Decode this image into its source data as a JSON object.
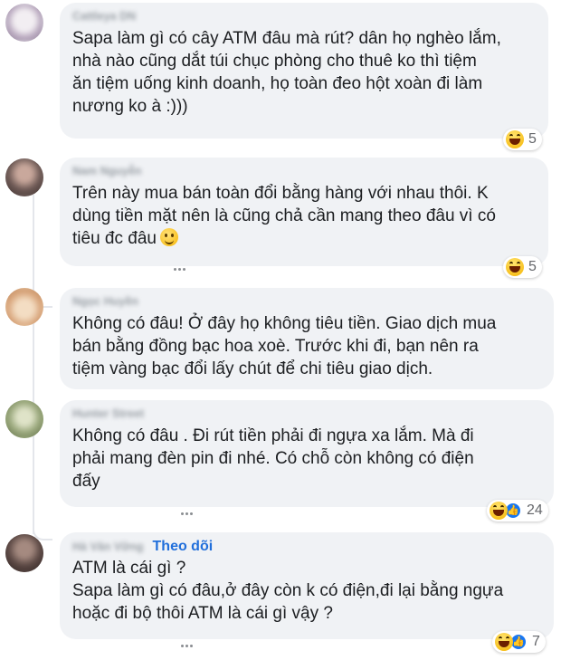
{
  "comments": [
    {
      "author": "Cattleya DN",
      "lines": [
        "Sapa làm gì có cây ATM đâu mà rút? dân họ nghèo lắm,",
        "nhà nào cũng dắt túi chục phòng cho thuê ko thì tiệm",
        "ăn tiệm uống kinh doanh, họ toàn đeo hột xoàn đi làm",
        "nương ko à :)))"
      ],
      "reactions": [
        "haha"
      ],
      "reaction_count": "5"
    },
    {
      "author": "Nam Nguyễn",
      "lines": [
        "Trên này mua bán toàn đổi bằng hàng với nhau thôi. K",
        "dùng tiền mặt nên là cũng chả cần mang theo đâu vì có",
        "tiêu đc đâu"
      ],
      "reactions": [
        "haha"
      ],
      "reaction_count": "5"
    },
    {
      "author": "Ngọc Huyền",
      "lines": [
        "Không có đâu! Ở đây họ không tiêu tiền. Giao dịch mua",
        "bán bằng đồng bạc hoa xoè. Trước khi đi, bạn nên ra",
        "tiệm vàng bạc đổi lấy chút để chi tiêu giao dịch."
      ]
    },
    {
      "author": "Hunter Street",
      "lines": [
        "Không có đâu . Đi rút tiền phải đi ngựa xa lắm. Mà đi",
        "phải mang đèn pin đi nhé. Có chỗ còn không có điện",
        "đấy"
      ],
      "reactions": [
        "haha",
        "like"
      ],
      "reaction_count": "24"
    },
    {
      "author": "Hà Văn Vững",
      "follow": "Theo dõi",
      "lines": [
        "ATM là cái gì ?",
        "Sapa làm gì có đâu,ở đây còn k có điện,đi lại bằng ngựa",
        "hoặc đi bộ thôi ATM là cái gì vậy ?"
      ],
      "reactions": [
        "haha",
        "like"
      ],
      "reaction_count": "7"
    }
  ],
  "colors": {
    "bubble": "#f0f2f5",
    "follow_link": "#216fdb",
    "like_blue": "#1877f2"
  }
}
